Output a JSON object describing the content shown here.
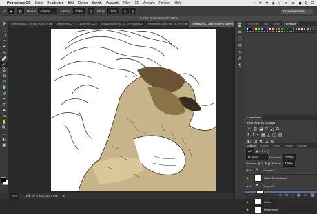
{
  "menubar": {
    "app": "Photoshop CC",
    "items": [
      "Datei",
      "Bearbeiten",
      "Bild",
      "Ebene",
      "Schrift",
      "Auswahl",
      "Filter",
      "3D",
      "Ansicht",
      "Fenster",
      "Hilfe"
    ],
    "right": [
      "◔",
      "⟳",
      "✱",
      "◉",
      "◇",
      "ᯤ",
      "🔊",
      "◼",
      "Q",
      "☰"
    ]
  },
  "options": {
    "mode_label": "Modus:",
    "mode_value": "Normal",
    "opacity_label": "Deckkr.:",
    "opacity_value": "100%",
    "flow_label": "Fluss:",
    "flow_value": "100%",
    "workspace": "Grundelemente"
  },
  "app_title": "Adobe Photoshop CC 2015",
  "doc_tabs": [
    "Unbenannt-1.psd bei 33,3% (Ebene 1, RGB/8)",
    "Unbenannt-2 + 4 - 1.psd bei 33,3% (Ebene...",
    "Imitation.psd bei 33,3% (paper1/3, RGB/8)",
    "Unbenannt-1.psd bei 33,3% (Ebene 0, RGB/8)",
    "Unbenannt-1.psd bei 50% (Ebene 0, RGB/8)"
  ],
  "active_tab": 4,
  "tools": [
    "✥",
    "⬚",
    "ʘ",
    "✂",
    "⌖",
    "✎",
    "🩹",
    "🖌",
    "⎙",
    "⟲",
    "◫",
    "💧",
    "◍",
    "✒",
    "T",
    "➤",
    "▭",
    "✋",
    "🔍",
    "…",
    "◧",
    "▣"
  ],
  "active_tool": 7,
  "colors": {
    "foreground": "#000000",
    "background": "#ffffff",
    "accent": "#5b6f8e"
  },
  "status": {
    "zoom": "50%",
    "doc": "Dok: 37,8 MB/280,7 MB"
  },
  "swatch_panel": {
    "tabs": [
      "Farbfelder",
      "Stile",
      "Farbe",
      "Farbfelder"
    ],
    "active": 3,
    "colors": [
      "#ffffff",
      "#000000",
      "#ff0000",
      "#ffff00",
      "#00ff00",
      "#00ffff",
      "#0000ff",
      "#ff00ff",
      "#e3e3e3",
      "#c8c8c8",
      "#b0b0b0",
      "#959595",
      "#7a7a7a",
      "#5f5f5f",
      "#444",
      "#2a2a2a",
      "#f26c4f",
      "#f68e55",
      "#fbaf5c",
      "#fff467",
      "#acd372",
      "#7cc576",
      "#3bb878",
      "#1abbb4",
      "#00bff3",
      "#438ccb",
      "#5574b9",
      "#605ca8",
      "#855fa8",
      "#a763a8",
      "#f06ea9",
      "#f26d7d",
      "#ed1c24",
      "#f26522",
      "#f7941d",
      "#fff200",
      "#8dc63f",
      "#39b54a",
      "#00a651",
      "#00a99d",
      "#00aeef",
      "#0072bc",
      "#0054a6",
      "#2e3192",
      "#662d91",
      "#92278f",
      "#ec008c",
      "#ed145b"
    ]
  },
  "adjust_panel": {
    "tabs": [
      "Korrekturen"
    ],
    "header": "Korrektur hinzufügen",
    "row1": [
      "☀",
      "▥",
      "◪",
      "▽",
      "◭",
      "⚖"
    ],
    "row2": [
      "◐",
      "◑",
      "◒",
      "▦",
      "◬",
      "◫",
      "▤"
    ],
    "row3": [
      "◧",
      "◨",
      "◩",
      "◮",
      "▧"
    ]
  },
  "layers_panel": {
    "tabs": [
      "Ebenen",
      "Kanäle",
      "Pfade",
      "Absatz",
      "Zeichen"
    ],
    "kind_label": "Art",
    "blend": "Normal",
    "opacity_label": "Deckkraft:",
    "opacity": "100%",
    "lock_label": "Fixieren:",
    "fill_label": "Fläche:",
    "fill": "100%",
    "layers": [
      {
        "name": "Gruppe 1",
        "type": "folder",
        "selected": false
      },
      {
        "name": "Hatch-Smartobjekt",
        "type": "layer",
        "selected": false
      },
      {
        "name": "Gruppe 3",
        "type": "folder",
        "selected": false
      },
      {
        "name": "Ebene 0",
        "type": "layer",
        "selected": true
      },
      {
        "name": "Chloe",
        "type": "layer",
        "selected": false
      },
      {
        "name": "Hintergrund",
        "type": "layer",
        "selected": false
      }
    ],
    "footer": [
      "⊘",
      "fx",
      "◐",
      "▣",
      "▭",
      "🗑"
    ]
  }
}
